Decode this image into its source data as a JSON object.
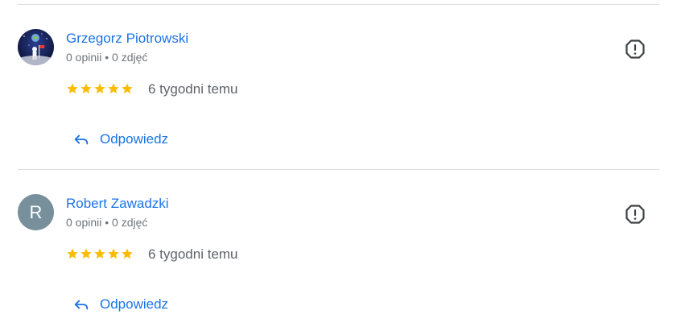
{
  "colors": {
    "link": "#1a73e8",
    "muted": "#70757a",
    "star": "#fbbc04",
    "divider": "#dadce0",
    "avatar_letter_bg": "#78909c"
  },
  "reviews": [
    {
      "name": "Grzegorz Piotrowski",
      "meta": "0 opinii • 0 zdjęć",
      "rating": 5,
      "date": "6 tygodni temu",
      "reply_label": "Odpowiedz",
      "avatar": "astronaut-photo"
    },
    {
      "name": "Robert Zawadzki",
      "meta": "0 opinii • 0 zdjęć",
      "rating": 5,
      "date": "6 tygodni temu",
      "reply_label": "Odpowiedz",
      "avatar_letter": "R"
    }
  ],
  "icons": {
    "report": "report-flag-icon",
    "reply": "reply-arrow-icon",
    "star": "star-icon"
  }
}
